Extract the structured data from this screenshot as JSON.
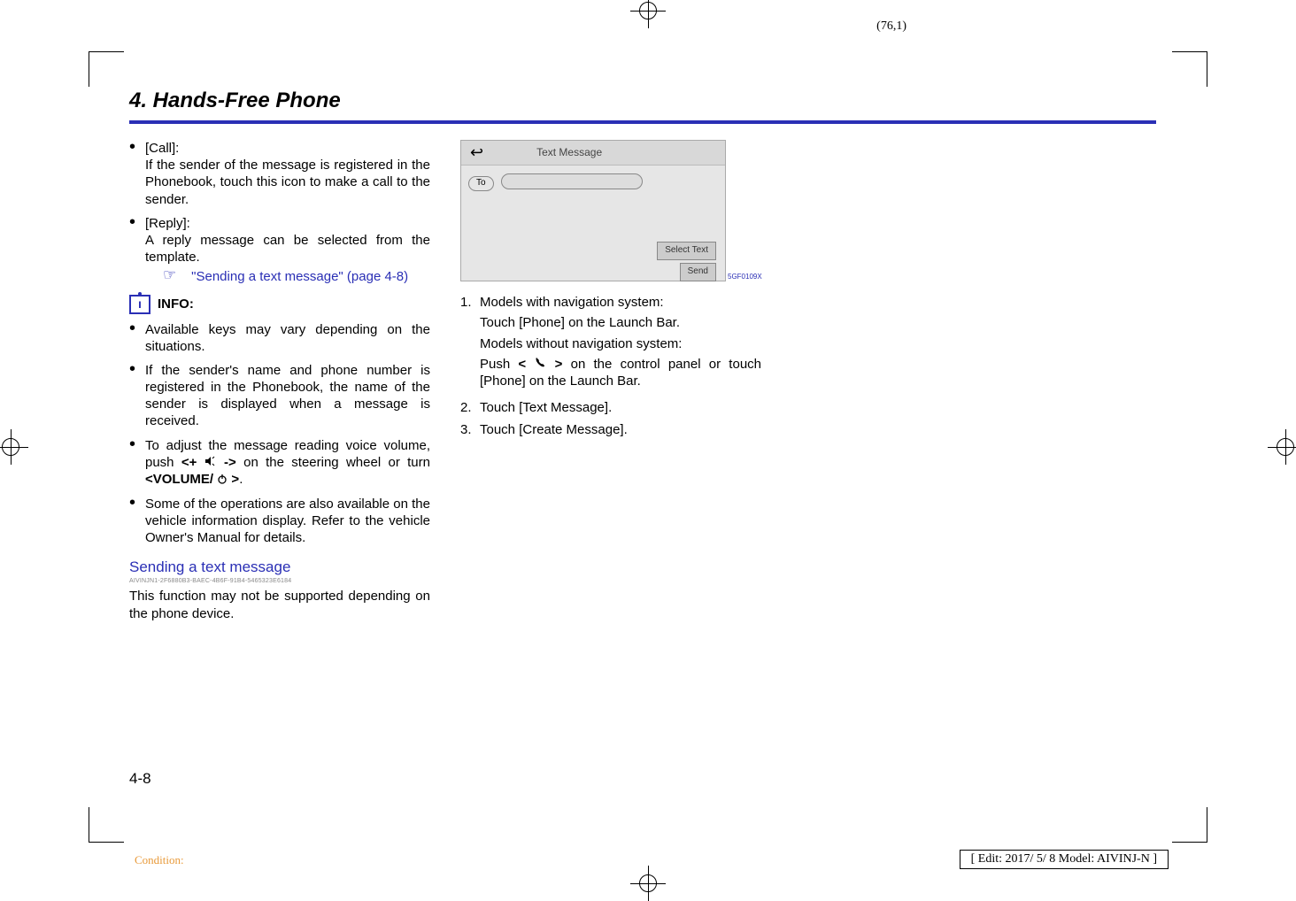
{
  "page_coords": "(76,1)",
  "section_title": "4. Hands-Free Phone",
  "col1": {
    "call_label": "[Call]:",
    "call_text": "If the sender of the message is registered in the Phonebook, touch this icon to make a call to the sender.",
    "reply_label": "[Reply]:",
    "reply_text": "A reply message can be selected from the template.",
    "reply_link": "\"Sending a text message\" (page 4-8)",
    "info_label": "INFO:",
    "info1": "Available keys may vary depending on the situations.",
    "info2": "If the sender's name and phone number is registered in the Phonebook, the name of the sender is displayed when a message is received.",
    "info3_a": "To adjust the message reading voice volume, push ",
    "info3_b1": "<+ ",
    "info3_b2": " ->",
    "info3_c": " on the steering wheel or turn ",
    "info3_d1": "<VOLUME/ ",
    "info3_d2": " >",
    "info3_e": ".",
    "info4": "Some of the operations are also available on the vehicle information display. Refer to the vehicle Owner's Manual for details.",
    "subhead": "Sending a text message",
    "guid": "AIVINJN1-2F6880B3-BAEC-4B6F-91B4-5465323E6184",
    "subtext": "This function may not be supported depending on the phone device."
  },
  "col2": {
    "ss_title": "Text Message",
    "ss_to": "To",
    "ss_select": "Select Text",
    "ss_send": "Send",
    "ss_code": "5GF0109X",
    "step1_num": "1.",
    "step1_a": "Models with navigation system:",
    "step1_b": "Touch [Phone] on the Launch Bar.",
    "step1_c": "Models without navigation system:",
    "step1_d_a": "Push ",
    "step1_d_b1": "< ",
    "step1_d_b2": " >",
    "step1_d_c": " on the control panel or touch [Phone] on the Launch Bar.",
    "step2_num": "2.",
    "step2": "Touch [Text Message].",
    "step3_num": "3.",
    "step3": "Touch [Create Message]."
  },
  "page_label": "4-8",
  "condition": "Condition:",
  "editbox": "[ Edit: 2017/ 5/ 8   Model: AIVINJ-N ]"
}
